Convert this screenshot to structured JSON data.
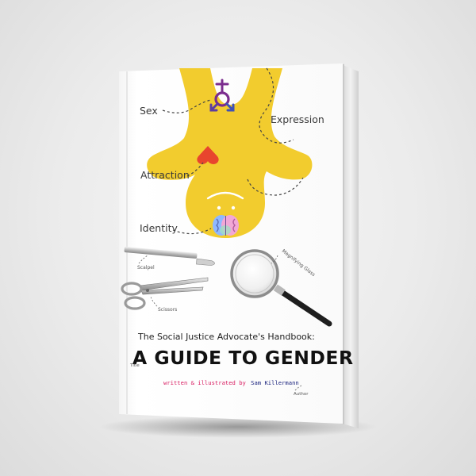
{
  "cover": {
    "labels": {
      "sex": "Sex",
      "expression": "Expression",
      "attraction": "Attraction",
      "identity": "Identity",
      "scalpel": "Scalpel",
      "scissors": "Scissors",
      "magnifying_glass": "Magnifying Glass",
      "title_tag": "Title",
      "author_tag": "Author"
    },
    "subtitle": "The Social Justice Advocate's Handbook:",
    "title": "A GUIDE TO GENDER",
    "credit_prefix": "written & illustrated by",
    "author": "Sam Killermann"
  },
  "colors": {
    "figure_yellow": "#F2CC2E",
    "heart_red": "#E8452E",
    "symbol_purple": "#7B2D8E",
    "symbol_blue": "#3F51B5",
    "credit_pink": "#D81B60",
    "credit_navy": "#1A237E",
    "cover_white": "#FFFFFF"
  },
  "icons": {
    "sex": "gender-symbol-icon",
    "attraction": "heart-icon",
    "identity": "brain-icon"
  }
}
